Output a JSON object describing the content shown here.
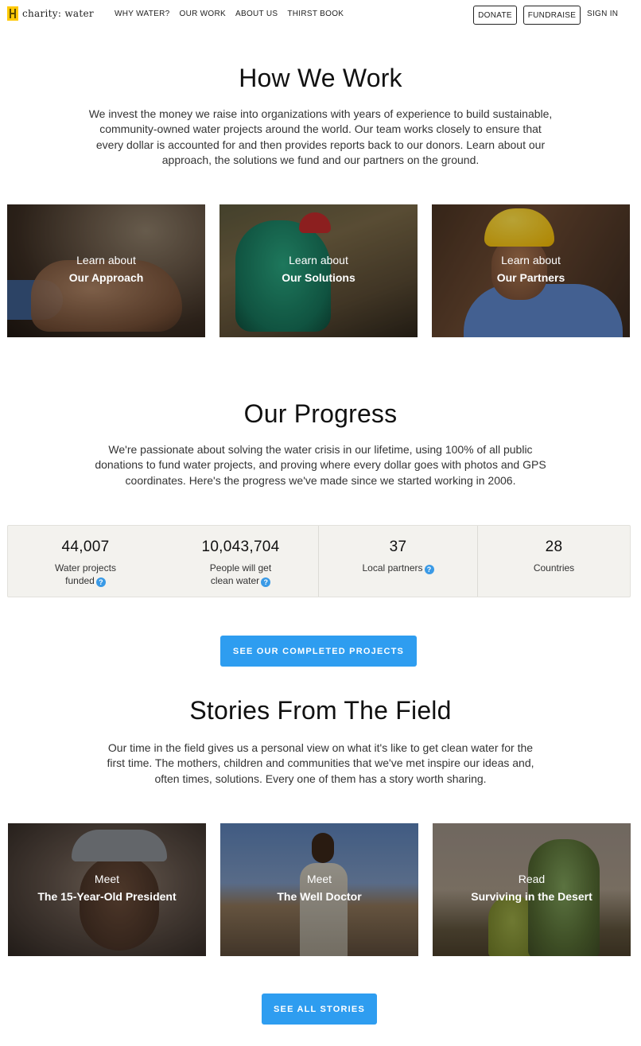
{
  "nav": {
    "logo_text": "charity: water",
    "links": [
      "WHY WATER?",
      "OUR WORK",
      "ABOUT US",
      "THIRST BOOK"
    ],
    "donate_label": "DONATE",
    "fundraise_label": "FUNDRAISE",
    "signin_label": "SIGN IN"
  },
  "how_we_work": {
    "title": "How We Work",
    "lines": [
      "We invest the money we raise into organizations with years of experience to build sustainable,",
      "community-owned water projects around the world. Our team works closely to ensure that",
      "every dollar is accounted for and then provides reports back to our donors. Learn about our",
      "approach, the solutions we fund and our partners on the ground."
    ],
    "cards": [
      {
        "pre": "Learn about",
        "title": "Our Approach"
      },
      {
        "pre": "Learn about",
        "title": "Our Solutions"
      },
      {
        "pre": "Learn about",
        "title": "Our Partners"
      }
    ]
  },
  "progress": {
    "title": "Our Progress",
    "lines": [
      "We're passionate about solving the water crisis in our lifetime, using 100% of all public",
      "donations to fund water projects, and proving where every dollar goes with photos and GPS",
      "coordinates. Here's the progress we've made since we started working in 2006."
    ],
    "stats": [
      {
        "value": "44,007",
        "label_line1": "Water projects",
        "label_line2": "funded"
      },
      {
        "value": "10,043,704",
        "label_line1": "People will get",
        "label_line2": "clean water"
      },
      {
        "value": "37",
        "label_line1": "Local partners",
        "label_line2": ""
      },
      {
        "value": "28",
        "label_line1": "Countries",
        "label_line2": ""
      }
    ],
    "button_label": "SEE OUR COMPLETED PROJECTS"
  },
  "stories": {
    "title": "Stories From The Field",
    "lines": [
      "Our time in the field gives us a personal view on what it's like to get clean water for the",
      "first time. The mothers, children and communities that we've met inspire our ideas and,",
      "often times, solutions. Every one of them has a story worth sharing."
    ],
    "cards": [
      {
        "pre": "Meet",
        "title": "The 15-Year-Old President"
      },
      {
        "pre": "Meet",
        "title": "The Well Doctor"
      },
      {
        "pre": "Read",
        "title": "Surviving in the Desert"
      }
    ],
    "button_label": "SEE ALL STORIES"
  },
  "icons": {
    "help": "question-circle-icon",
    "logo": "jerrycan-logo-icon"
  },
  "colors": {
    "accent": "#2e9df0",
    "logo_yellow": "#ffc907",
    "stats_bg": "#f3f2ee"
  }
}
